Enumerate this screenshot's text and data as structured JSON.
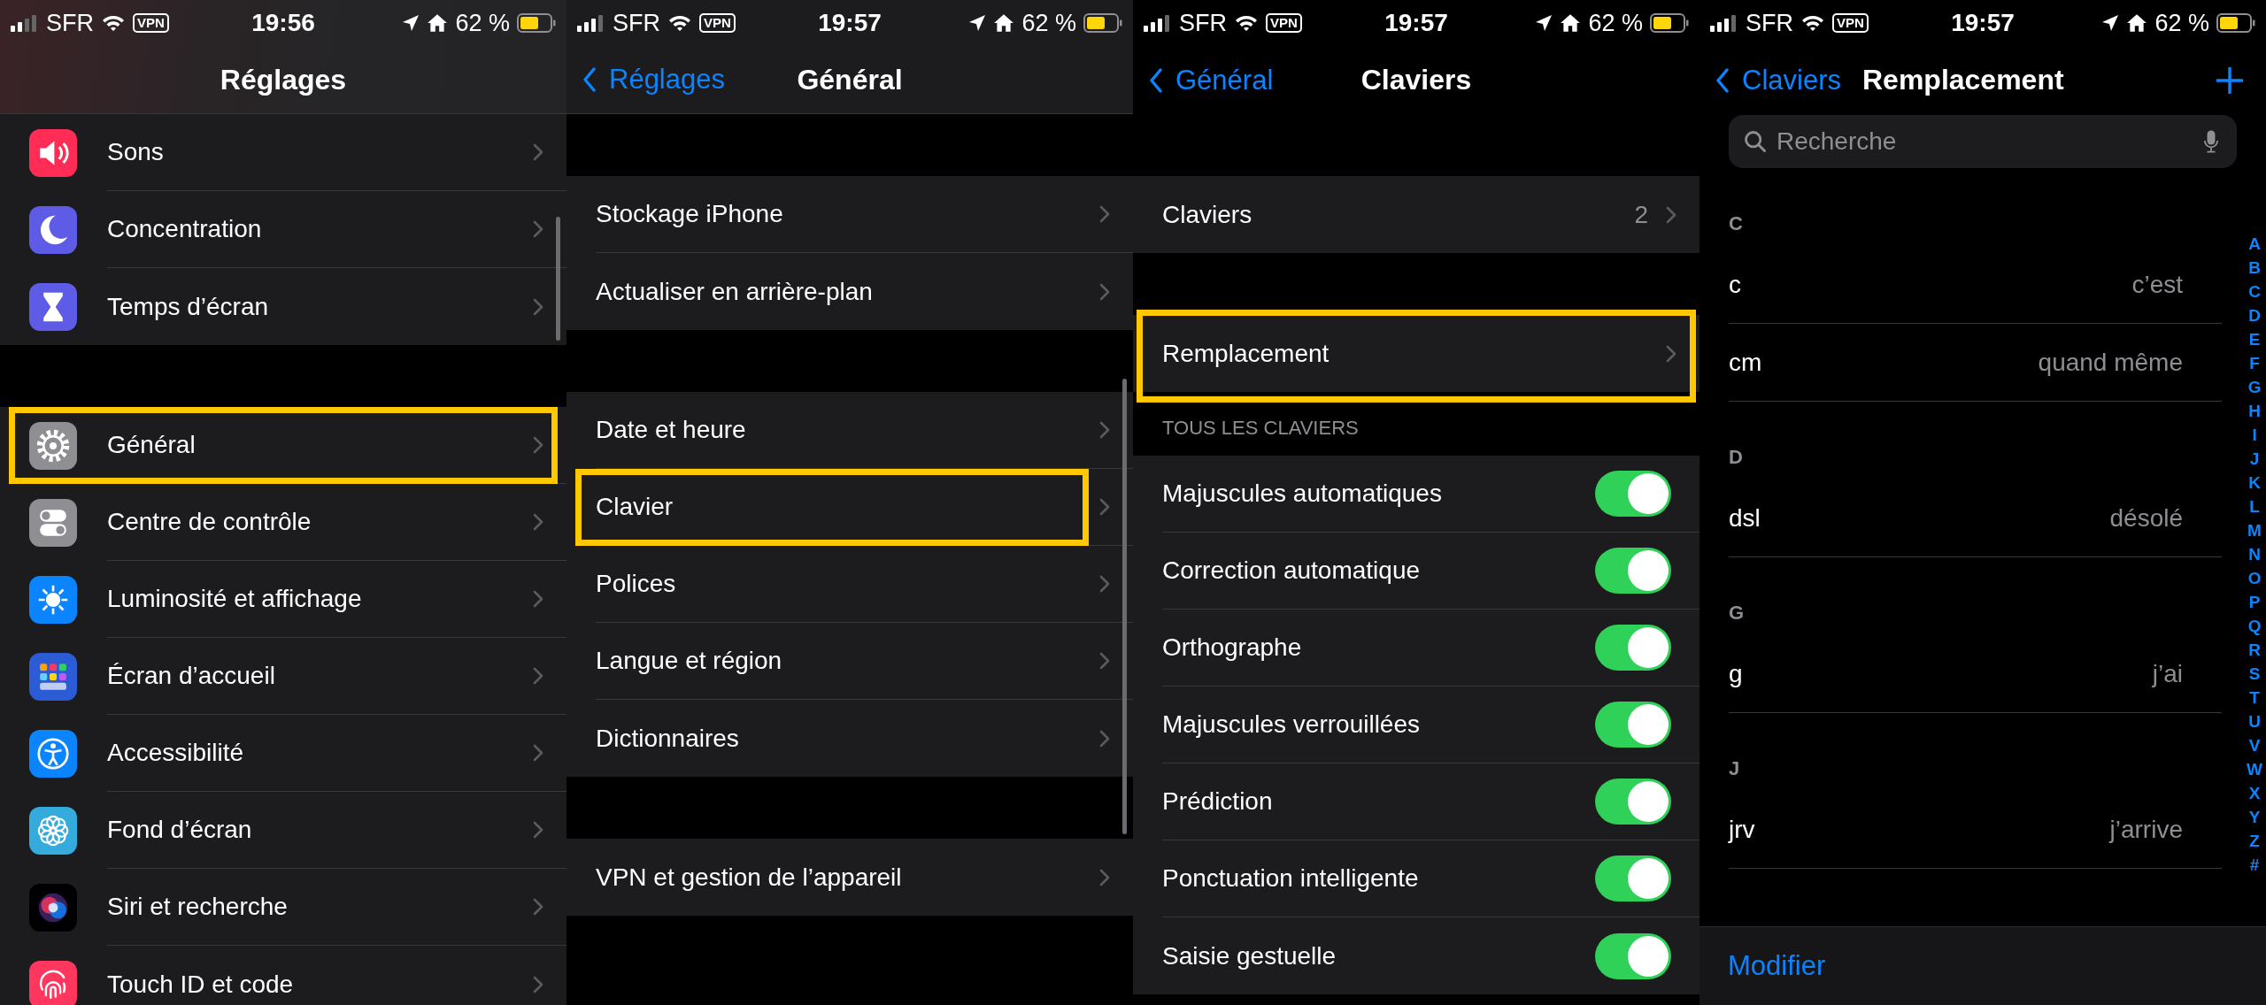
{
  "panels": [
    {
      "kind": "root",
      "status": {
        "carrier": "SFR",
        "vpn": "VPN",
        "time": "19:56",
        "battery": "62 %"
      },
      "nav": {
        "title": "Réglages",
        "scrolled": true
      },
      "groups": [
        {
          "rows": [
            {
              "kind": "link",
              "label": "Sons",
              "color": "#ff2d55",
              "highlighted": false
            },
            {
              "kind": "link",
              "label": "Concentration",
              "color": "#5e5ce6",
              "highlighted": false
            },
            {
              "kind": "link",
              "label": "Temps d’écran",
              "color": "#5e5ce6",
              "highlighted": false
            }
          ]
        },
        {
          "rows": [
            {
              "kind": "link",
              "label": "Général",
              "color": "#8e8e93",
              "highlighted": true
            },
            {
              "kind": "link",
              "label": "Centre de contrôle",
              "color": "#8e8e93",
              "highlighted": false
            },
            {
              "kind": "link",
              "label": "Luminosité et affichage",
              "color": "#0a84ff",
              "highlighted": false
            },
            {
              "kind": "link",
              "label": "Écran d’accueil",
              "color": "#2c5bd6",
              "highlighted": false
            },
            {
              "kind": "link",
              "label": "Accessibilité",
              "color": "#0a84ff",
              "highlighted": false
            },
            {
              "kind": "link",
              "label": "Fond d’écran",
              "color": "#35aadc",
              "highlighted": false
            },
            {
              "kind": "link",
              "label": "Siri et recherche",
              "color": "#000000",
              "highlighted": false
            },
            {
              "kind": "link",
              "label": "Touch ID et code",
              "color": "#ff375f",
              "highlighted": false
            }
          ]
        }
      ]
    },
    {
      "kind": "detail",
      "status": {
        "carrier": "SFR",
        "vpn": "VPN",
        "time": "19:57",
        "battery": "62 %"
      },
      "nav": {
        "title": "Général",
        "back": "Réglages",
        "scrolled": true
      },
      "groups": [
        {
          "rows": [
            {
              "kind": "link",
              "label": "Stockage iPhone",
              "highlighted": false
            },
            {
              "kind": "link",
              "label": "Actualiser en arrière-plan",
              "highlighted": false
            }
          ]
        },
        {
          "rows": [
            {
              "kind": "link",
              "label": "Date et heure",
              "highlighted": false
            },
            {
              "kind": "link",
              "label": "Clavier",
              "highlighted": true
            },
            {
              "kind": "link",
              "label": "Polices",
              "highlighted": false
            },
            {
              "kind": "link",
              "label": "Langue et région",
              "highlighted": false
            },
            {
              "kind": "link",
              "label": "Dictionnaires",
              "highlighted": false
            }
          ]
        },
        {
          "rows": [
            {
              "kind": "link",
              "label": "VPN et gestion de l’appareil",
              "highlighted": false
            }
          ]
        }
      ]
    },
    {
      "kind": "detail",
      "status": {
        "carrier": "SFR",
        "vpn": "VPN",
        "time": "19:57",
        "battery": "62 %"
      },
      "nav": {
        "title": "Claviers",
        "back": "Général",
        "scrolled": false
      },
      "groups": [
        {
          "rows": [
            {
              "kind": "link",
              "label": "Claviers",
              "value": "2",
              "highlighted": false
            }
          ]
        },
        {
          "rows": [
            {
              "kind": "link",
              "label": "Remplacement",
              "highlighted": true
            }
          ]
        },
        {
          "header": "TOUS LES CLAVIERS",
          "rows": [
            {
              "kind": "toggle",
              "label": "Majuscules automatiques",
              "on": true
            },
            {
              "kind": "toggle",
              "label": "Correction automatique",
              "on": true
            },
            {
              "kind": "toggle",
              "label": "Orthographe",
              "on": true
            },
            {
              "kind": "toggle",
              "label": "Majuscules verrouillées",
              "on": true
            },
            {
              "kind": "toggle",
              "label": "Prédiction",
              "on": true
            },
            {
              "kind": "toggle",
              "label": "Ponctuation intelligente",
              "on": true
            },
            {
              "kind": "toggle",
              "label": "Saisie gestuelle",
              "on": true
            }
          ]
        }
      ]
    },
    {
      "kind": "replacements",
      "status": {
        "carrier": "SFR",
        "vpn": "VPN",
        "time": "19:57",
        "battery": "62 %"
      },
      "nav": {
        "title": "Remplacement",
        "back": "Claviers",
        "scrolled": false
      },
      "search": {
        "placeholder": "Recherche"
      },
      "sections": [
        {
          "letter": "C",
          "rows": [
            {
              "shortcut": "c",
              "phrase": "c’est"
            },
            {
              "shortcut": "cm",
              "phrase": "quand même"
            }
          ]
        },
        {
          "letter": "D",
          "rows": [
            {
              "shortcut": "dsl",
              "phrase": "désolé"
            }
          ]
        },
        {
          "letter": "G",
          "rows": [
            {
              "shortcut": "g",
              "phrase": "j’ai"
            }
          ]
        },
        {
          "letter": "J",
          "rows": [
            {
              "shortcut": "jrv",
              "phrase": "j’arrive"
            }
          ]
        }
      ],
      "index": [
        "A",
        "B",
        "C",
        "D",
        "E",
        "F",
        "G",
        "H",
        "I",
        "J",
        "K",
        "L",
        "M",
        "N",
        "O",
        "P",
        "Q",
        "R",
        "S",
        "T",
        "U",
        "V",
        "W",
        "X",
        "Y",
        "Z",
        "#"
      ],
      "toolbar": {
        "button": "Modifier"
      }
    }
  ]
}
